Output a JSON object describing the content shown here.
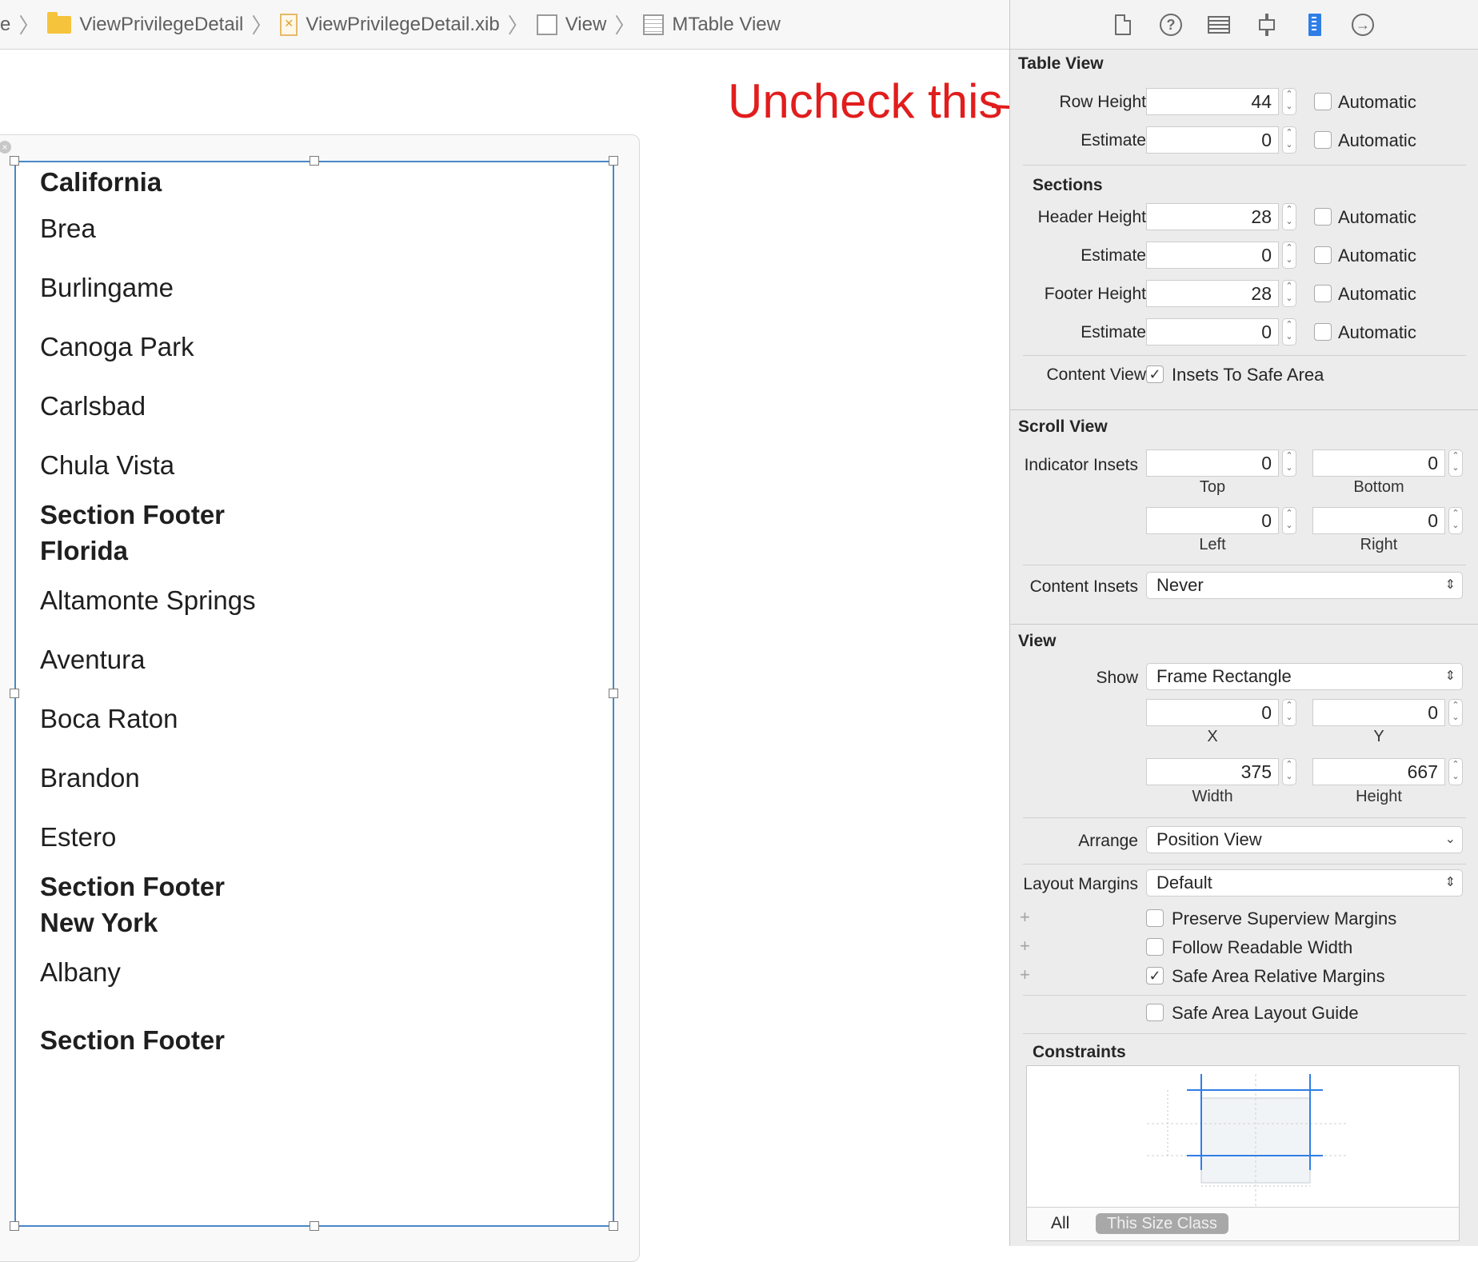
{
  "breadcrumb": {
    "items": [
      {
        "label": "e",
        "icon": ""
      },
      {
        "label": "ViewPrivilegeDetail",
        "icon": "folder-icon"
      },
      {
        "label": "ViewPrivilegeDetail.xib",
        "icon": "xib-file-icon"
      },
      {
        "label": "View",
        "icon": "view-icon"
      },
      {
        "label": "MTable View",
        "icon": "table-view-icon"
      }
    ]
  },
  "annotation": {
    "text": "Uncheck this",
    "color": "#e11d1d"
  },
  "table_rows": [
    {
      "text": "California",
      "kind": "header"
    },
    {
      "text": "Brea",
      "kind": "cell"
    },
    {
      "text": "Burlingame",
      "kind": "cell"
    },
    {
      "text": "Canoga Park",
      "kind": "cell"
    },
    {
      "text": "Carlsbad",
      "kind": "cell"
    },
    {
      "text": "Chula Vista",
      "kind": "cell"
    },
    {
      "text": "Section Footer",
      "kind": "footer"
    },
    {
      "text": "Florida",
      "kind": "header"
    },
    {
      "text": "Altamonte Springs",
      "kind": "cell"
    },
    {
      "text": "Aventura",
      "kind": "cell"
    },
    {
      "text": "Boca Raton",
      "kind": "cell"
    },
    {
      "text": "Brandon",
      "kind": "cell"
    },
    {
      "text": "Estero",
      "kind": "cell"
    },
    {
      "text": "Section Footer",
      "kind": "footer"
    },
    {
      "text": "New York",
      "kind": "header"
    },
    {
      "text": "Albany",
      "kind": "cell"
    },
    {
      "text": "Section Footer",
      "kind": "footer"
    }
  ],
  "inspector": {
    "tab_icons": [
      "file-inspector-icon",
      "quick-help-icon",
      "identity-inspector-icon",
      "attributes-inspector-icon",
      "size-inspector-icon",
      "connections-inspector-icon"
    ],
    "active_tab": "size-inspector-icon",
    "table_view": {
      "title": "Table View",
      "row_height_label": "Row Height",
      "row_height": "44",
      "estimate_label": "Estimate",
      "estimate": "0",
      "automatic_label": "Automatic",
      "row_automatic": false,
      "estimate_automatic": false
    },
    "sections": {
      "title": "Sections",
      "header_height_label": "Header Height",
      "header_height": "28",
      "header_estimate_label": "Estimate",
      "header_estimate": "0",
      "footer_height_label": "Footer Height",
      "footer_height": "28",
      "footer_estimate_label": "Estimate",
      "footer_estimate": "0",
      "automatic_label": "Automatic",
      "content_view_label": "Content View",
      "insets_label": "Insets To Safe Area",
      "insets_checked": true
    },
    "scroll_view": {
      "title": "Scroll View",
      "indicator_insets_label": "Indicator Insets",
      "top": "0",
      "top_label": "Top",
      "bottom": "0",
      "bottom_label": "Bottom",
      "left": "0",
      "left_label": "Left",
      "right": "0",
      "right_label": "Right",
      "content_insets_label": "Content Insets",
      "content_insets": "Never"
    },
    "view": {
      "title": "View",
      "show_label": "Show",
      "show": "Frame Rectangle",
      "x": "0",
      "x_label": "X",
      "y": "0",
      "y_label": "Y",
      "width": "375",
      "width_label": "Width",
      "height": "667",
      "height_label": "Height",
      "arrange_label": "Arrange",
      "arrange": "Position View",
      "layout_margins_label": "Layout Margins",
      "layout_margins": "Default",
      "preserve_label": "Preserve Superview Margins",
      "preserve_checked": false,
      "readable_label": "Follow Readable Width",
      "readable_checked": false,
      "safe_area_margins_label": "Safe Area Relative Margins",
      "safe_area_margins_checked": true,
      "safe_area_guide_label": "Safe Area Layout Guide",
      "safe_area_guide_checked": false
    },
    "constraints": {
      "title": "Constraints",
      "all_label": "All",
      "size_class_label": "This Size Class"
    }
  }
}
